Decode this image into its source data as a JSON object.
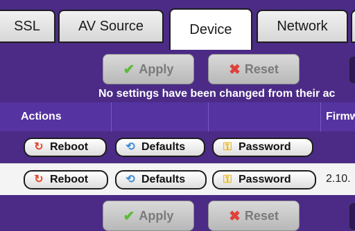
{
  "tabs": [
    {
      "label": "SSL",
      "active": false
    },
    {
      "label": "AV Source",
      "active": false
    },
    {
      "label": "Device",
      "active": true
    },
    {
      "label": "Network",
      "active": false
    }
  ],
  "top_buttons": {
    "apply": "Apply",
    "reset": "Reset"
  },
  "notice": "No settings have been changed from their ac",
  "table": {
    "headers": {
      "actions": "Actions",
      "firmware": "Firmw"
    }
  },
  "rows": [
    {
      "reboot": "Reboot",
      "defaults": "Defaults",
      "password": "Password",
      "firmware": ""
    },
    {
      "reboot": "Reboot",
      "defaults": "Defaults",
      "password": "Password",
      "firmware": "2.10."
    }
  ],
  "bottom_buttons": {
    "apply": "Apply",
    "reset": "Reset"
  },
  "colors": {
    "background": "#4b2b86",
    "header": "#5533a0",
    "row_alt": "#f4f4f4"
  },
  "icons": {
    "apply": "checkmark-icon",
    "reset": "cross-icon",
    "reboot": "reboot-icon",
    "defaults": "defaults-icon",
    "password": "key-icon"
  }
}
